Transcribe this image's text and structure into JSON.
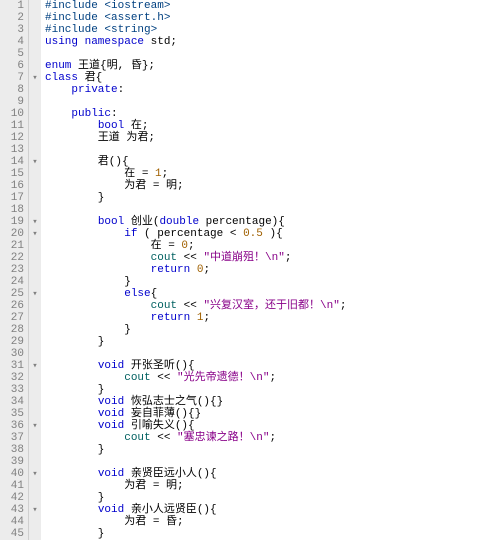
{
  "lines": [
    {
      "n": 1,
      "f": "",
      "segs": [
        {
          "c": "pp",
          "t": "#include <iostream>"
        }
      ]
    },
    {
      "n": 2,
      "f": "",
      "segs": [
        {
          "c": "pp",
          "t": "#include <assert.h>"
        }
      ]
    },
    {
      "n": 3,
      "f": "",
      "segs": [
        {
          "c": "pp",
          "t": "#include <string>"
        }
      ]
    },
    {
      "n": 4,
      "f": "",
      "segs": [
        {
          "c": "kw",
          "t": "using "
        },
        {
          "c": "kw",
          "t": "namespace "
        },
        {
          "t": "std;"
        }
      ]
    },
    {
      "n": 5,
      "f": "",
      "segs": [
        {
          "t": ""
        }
      ]
    },
    {
      "n": 6,
      "f": "",
      "segs": [
        {
          "c": "kw",
          "t": "enum "
        },
        {
          "t": "王道{明, 昏};"
        }
      ]
    },
    {
      "n": 7,
      "f": "▾",
      "segs": [
        {
          "c": "kw",
          "t": "class "
        },
        {
          "t": "君{"
        }
      ]
    },
    {
      "n": 8,
      "f": "",
      "segs": [
        {
          "t": "    "
        },
        {
          "c": "kw",
          "t": "private"
        },
        {
          "t": ":"
        }
      ]
    },
    {
      "n": 9,
      "f": "",
      "segs": [
        {
          "t": ""
        }
      ]
    },
    {
      "n": 10,
      "f": "",
      "segs": [
        {
          "t": "    "
        },
        {
          "c": "kw",
          "t": "public"
        },
        {
          "t": ":"
        }
      ]
    },
    {
      "n": 11,
      "f": "",
      "segs": [
        {
          "t": "        "
        },
        {
          "c": "kw",
          "t": "bool "
        },
        {
          "t": "在;"
        }
      ]
    },
    {
      "n": 12,
      "f": "",
      "segs": [
        {
          "t": "        王道 为君;"
        }
      ]
    },
    {
      "n": 13,
      "f": "",
      "segs": [
        {
          "t": ""
        }
      ]
    },
    {
      "n": 14,
      "f": "▾",
      "segs": [
        {
          "t": "        君(){"
        }
      ]
    },
    {
      "n": 15,
      "f": "",
      "segs": [
        {
          "t": "            在 = "
        },
        {
          "c": "num",
          "t": "1"
        },
        {
          "t": ";"
        }
      ]
    },
    {
      "n": 16,
      "f": "",
      "segs": [
        {
          "t": "            为君 = 明;"
        }
      ]
    },
    {
      "n": 17,
      "f": "",
      "segs": [
        {
          "t": "        }"
        }
      ]
    },
    {
      "n": 18,
      "f": "",
      "segs": [
        {
          "t": ""
        }
      ]
    },
    {
      "n": 19,
      "f": "▾",
      "segs": [
        {
          "t": "        "
        },
        {
          "c": "kw",
          "t": "bool "
        },
        {
          "t": "创业("
        },
        {
          "c": "kw",
          "t": "double "
        },
        {
          "t": "percentage){"
        }
      ]
    },
    {
      "n": 20,
      "f": "▾",
      "segs": [
        {
          "t": "            "
        },
        {
          "c": "kw",
          "t": "if "
        },
        {
          "t": "( percentage < "
        },
        {
          "c": "num",
          "t": "0.5 "
        },
        {
          "t": "){"
        }
      ]
    },
    {
      "n": 21,
      "f": "",
      "segs": [
        {
          "t": "                在 = "
        },
        {
          "c": "num",
          "t": "0"
        },
        {
          "t": ";"
        }
      ]
    },
    {
      "n": 22,
      "f": "",
      "segs": [
        {
          "t": "                "
        },
        {
          "c": "cls",
          "t": "cout"
        },
        {
          "t": " << "
        },
        {
          "c": "str",
          "t": "\"中道崩殂！\\n\""
        },
        {
          "t": ";"
        }
      ]
    },
    {
      "n": 23,
      "f": "",
      "segs": [
        {
          "t": "                "
        },
        {
          "c": "kw",
          "t": "return "
        },
        {
          "c": "num",
          "t": "0"
        },
        {
          "t": ";"
        }
      ]
    },
    {
      "n": 24,
      "f": "",
      "segs": [
        {
          "t": "            }"
        }
      ]
    },
    {
      "n": 25,
      "f": "▾",
      "segs": [
        {
          "t": "            "
        },
        {
          "c": "kw",
          "t": "else"
        },
        {
          "t": "{"
        }
      ]
    },
    {
      "n": 26,
      "f": "",
      "segs": [
        {
          "t": "                "
        },
        {
          "c": "cls",
          "t": "cout"
        },
        {
          "t": " << "
        },
        {
          "c": "str",
          "t": "\"兴复汉室，还于旧都！\\n\""
        },
        {
          "t": ";"
        }
      ]
    },
    {
      "n": 27,
      "f": "",
      "segs": [
        {
          "t": "                "
        },
        {
          "c": "kw",
          "t": "return "
        },
        {
          "c": "num",
          "t": "1"
        },
        {
          "t": ";"
        }
      ]
    },
    {
      "n": 28,
      "f": "",
      "segs": [
        {
          "t": "            }"
        }
      ]
    },
    {
      "n": 29,
      "f": "",
      "segs": [
        {
          "t": "        }"
        }
      ]
    },
    {
      "n": 30,
      "f": "",
      "segs": [
        {
          "t": ""
        }
      ]
    },
    {
      "n": 31,
      "f": "▾",
      "segs": [
        {
          "t": "        "
        },
        {
          "c": "kw",
          "t": "void "
        },
        {
          "t": "开张圣听(){"
        }
      ]
    },
    {
      "n": 32,
      "f": "",
      "segs": [
        {
          "t": "            "
        },
        {
          "c": "cls",
          "t": "cout"
        },
        {
          "t": " << "
        },
        {
          "c": "str",
          "t": "\"光先帝遗德！\\n\""
        },
        {
          "t": ";"
        }
      ]
    },
    {
      "n": 33,
      "f": "",
      "segs": [
        {
          "t": "        }"
        }
      ]
    },
    {
      "n": 34,
      "f": "",
      "segs": [
        {
          "t": "        "
        },
        {
          "c": "kw",
          "t": "void "
        },
        {
          "t": "恢弘志士之气(){}"
        }
      ]
    },
    {
      "n": 35,
      "f": "",
      "segs": [
        {
          "t": "        "
        },
        {
          "c": "kw",
          "t": "void "
        },
        {
          "t": "妄自菲薄(){}"
        }
      ]
    },
    {
      "n": 36,
      "f": "▾",
      "segs": [
        {
          "t": "        "
        },
        {
          "c": "kw",
          "t": "void "
        },
        {
          "t": "引喻失义(){"
        }
      ]
    },
    {
      "n": 37,
      "f": "",
      "segs": [
        {
          "t": "            "
        },
        {
          "c": "cls",
          "t": "cout"
        },
        {
          "t": " << "
        },
        {
          "c": "str",
          "t": "\"塞忠谏之路！\\n\""
        },
        {
          "t": ";"
        }
      ]
    },
    {
      "n": 38,
      "f": "",
      "segs": [
        {
          "t": "        }"
        }
      ]
    },
    {
      "n": 39,
      "f": "",
      "segs": [
        {
          "t": ""
        }
      ]
    },
    {
      "n": 40,
      "f": "▾",
      "segs": [
        {
          "t": "        "
        },
        {
          "c": "kw",
          "t": "void "
        },
        {
          "t": "亲贤臣远小人(){"
        }
      ]
    },
    {
      "n": 41,
      "f": "",
      "segs": [
        {
          "t": "            为君 = 明;"
        }
      ]
    },
    {
      "n": 42,
      "f": "",
      "segs": [
        {
          "t": "        }"
        }
      ]
    },
    {
      "n": 43,
      "f": "▾",
      "segs": [
        {
          "t": "        "
        },
        {
          "c": "kw",
          "t": "void "
        },
        {
          "t": "亲小人远贤臣(){"
        }
      ]
    },
    {
      "n": 44,
      "f": "",
      "segs": [
        {
          "t": "            为君 = 昏;"
        }
      ]
    },
    {
      "n": 45,
      "f": "",
      "segs": [
        {
          "t": "        }"
        }
      ]
    }
  ]
}
